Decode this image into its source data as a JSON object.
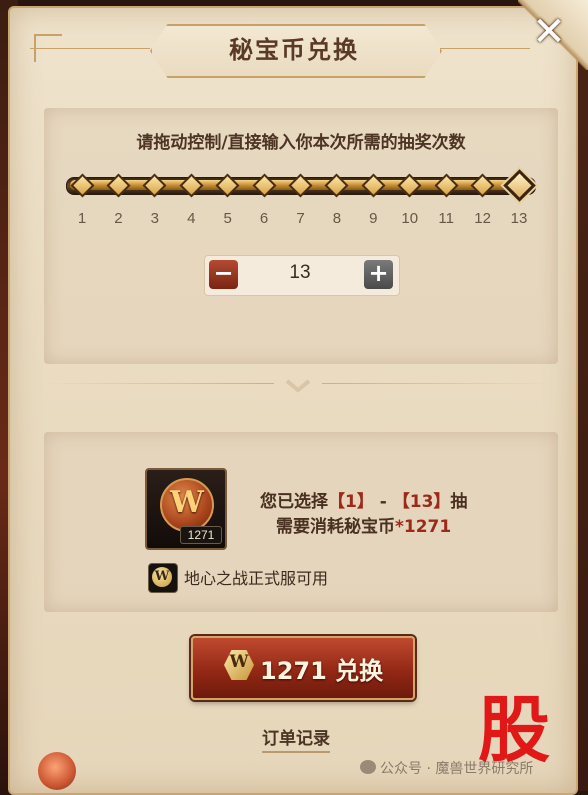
{
  "window": {
    "title": "秘宝币兑换",
    "close_glyph": "✕"
  },
  "instruction": "请拖动控制/直接输入你本次所需的抽奖次数",
  "slider": {
    "min": 1,
    "max": 13,
    "value": 13,
    "ticks": [
      "1",
      "2",
      "3",
      "4",
      "5",
      "6",
      "7",
      "8",
      "9",
      "10",
      "11",
      "12",
      "13"
    ]
  },
  "stepper": {
    "minus": "−",
    "plus": "+",
    "value": "13"
  },
  "selection": {
    "line1_prefix": "您已选择",
    "line1_from": "【1】",
    "line1_dash": " - ",
    "line1_to": "【13】",
    "line1_suffix": "抽",
    "line2_prefix": "需要消耗秘宝币",
    "line2_amount": "*1271"
  },
  "item": {
    "icon": "wow-coin-icon",
    "coin_letter": "W",
    "count": "1271"
  },
  "availability": {
    "icon_letter": "W",
    "text": "地心之战正式服可用"
  },
  "exchange_button": {
    "icon_letter": "W",
    "label": "1271 兑换"
  },
  "order_link": "订单记录",
  "watermark": {
    "text": "公众号 · 魔兽世界研究所",
    "stamp": "股"
  },
  "colors": {
    "parchment": "#eadcc2",
    "accent_red": "#9c2a1a",
    "button_red": "#932814",
    "gold": "#d8a448"
  }
}
